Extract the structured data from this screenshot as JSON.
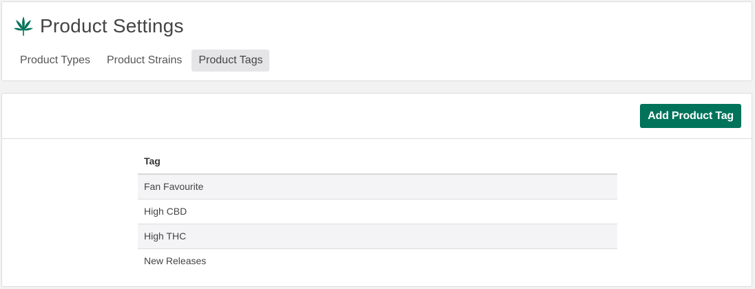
{
  "header": {
    "icon": "cannabis-leaf-icon",
    "title": "Product Settings",
    "accent_color": "#00735a"
  },
  "tabs": [
    {
      "label": "Product Types",
      "active": false
    },
    {
      "label": "Product Strains",
      "active": false
    },
    {
      "label": "Product Tags",
      "active": true
    }
  ],
  "toolbar": {
    "add_label": "Add Product Tag"
  },
  "table": {
    "columns": [
      "Tag"
    ],
    "rows": [
      {
        "tag": "Fan Favourite"
      },
      {
        "tag": "High CBD"
      },
      {
        "tag": "High THC"
      },
      {
        "tag": "New Releases"
      }
    ]
  }
}
